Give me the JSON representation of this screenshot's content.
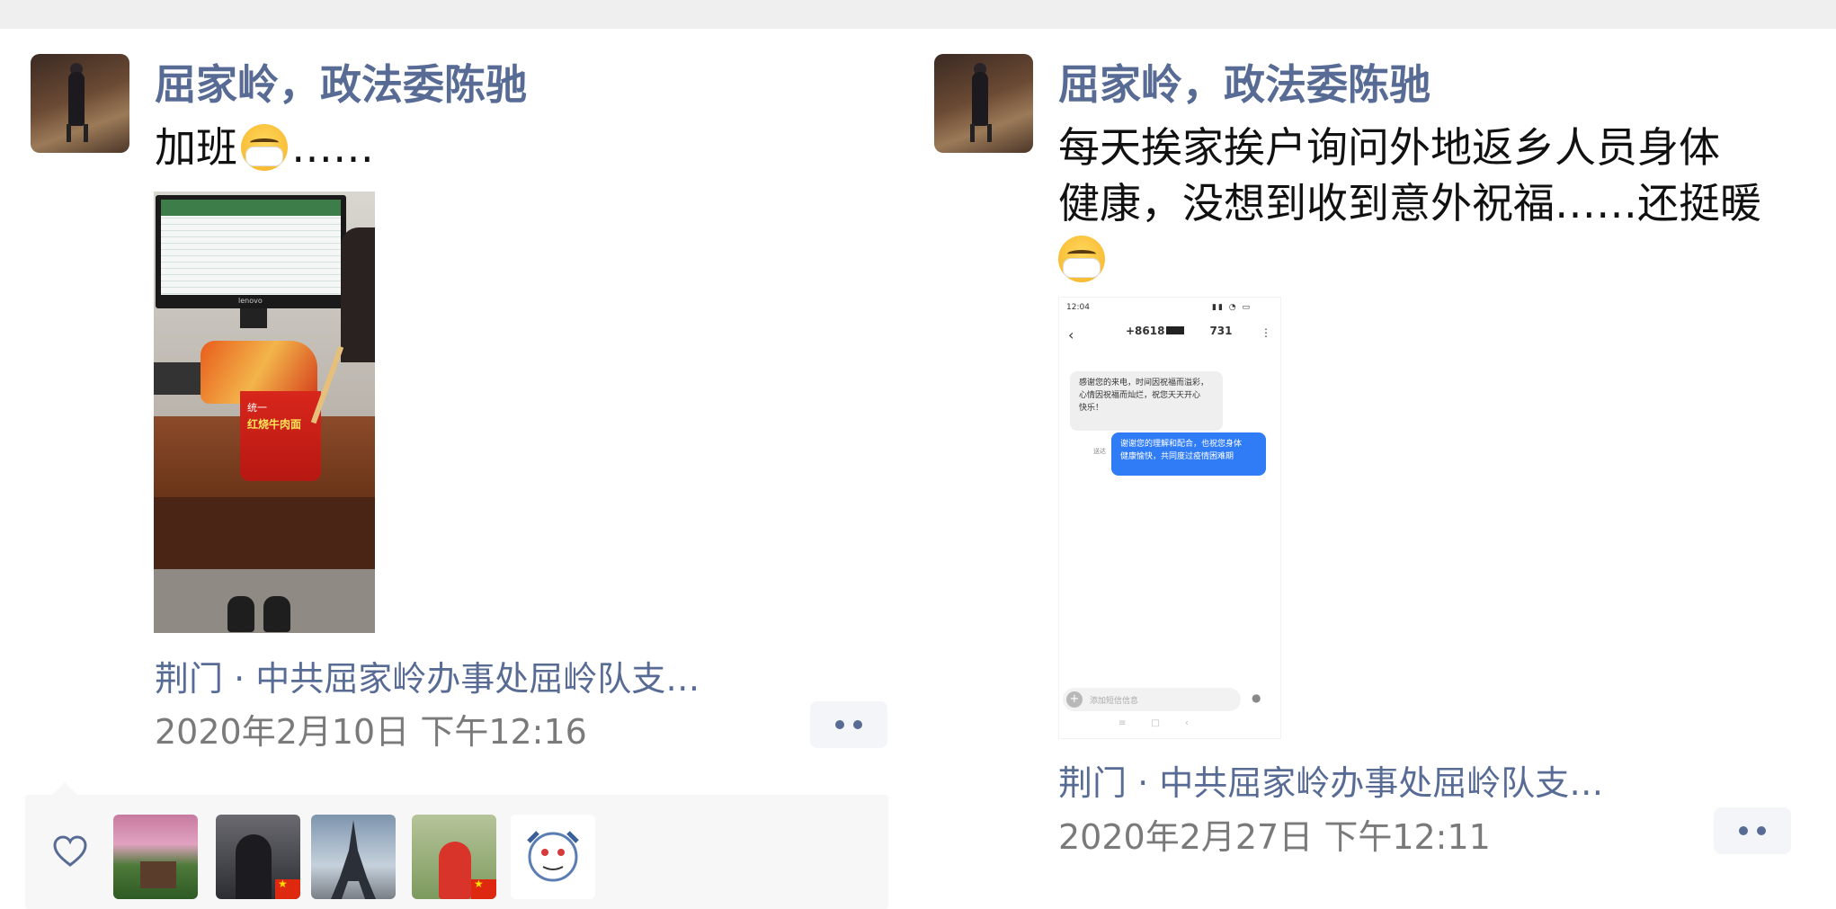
{
  "posts": [
    {
      "author": "屈家岭，政法委陈驰",
      "text_before_emoji": "加班",
      "text_after_emoji": "……",
      "emoji": "mask-face-emoji",
      "location": "荆门 · 中共屈家岭办事处屈岭队支…",
      "time": "2020年2月10日 下午12:16",
      "photo_labels": {
        "monitor_brand": "lenovo",
        "cup_brand": "统一",
        "cup_text": "红烧牛肉面"
      },
      "likes": [
        "liker-1",
        "liker-2",
        "liker-3",
        "liker-4",
        "liker-5"
      ]
    },
    {
      "author": "屈家岭，政法委陈驰",
      "text_line1": "每天挨家挨户询问外地返乡人员身体",
      "text_line2": "健康，没想到收到意外祝福……还挺暖",
      "emoji": "mask-face-emoji",
      "location": "荆门 · 中共屈家岭办事处屈岭队支…",
      "time": "2020年2月27日 下午12:11",
      "phone": {
        "status_time": "12:04",
        "contact": "+8618",
        "contact_suffix": "731",
        "incoming_line1": "感谢您的来电，时间因祝福而溢彩，",
        "incoming_line2": "心情因祝福而灿烂，祝您天天开心",
        "incoming_line3": "快乐！",
        "outgoing_line1": "谢谢您的理解和配合，也祝您身体",
        "outgoing_line2": "健康愉快，共同度过疫情困难期",
        "read_label": "送达",
        "input_placeholder": "添加短信信息"
      }
    }
  ],
  "colors": {
    "link": "#576b95",
    "text": "#111111",
    "meta": "#7a7a7a",
    "bubble_out": "#2f7cf6",
    "bubble_in": "#efefef"
  }
}
